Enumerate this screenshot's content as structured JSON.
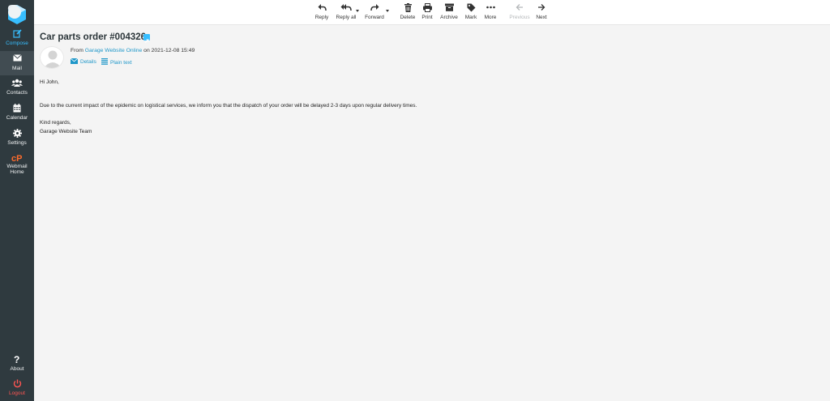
{
  "sidebar": {
    "items": [
      {
        "label": "Compose",
        "icon": "compose-icon"
      },
      {
        "label": "Mail",
        "icon": "mail-icon"
      },
      {
        "label": "Contacts",
        "icon": "contacts-icon"
      },
      {
        "label": "Calendar",
        "icon": "calendar-icon"
      },
      {
        "label": "Settings",
        "icon": "gear-icon"
      },
      {
        "label": "Webmail",
        "label2": "Home",
        "icon": "cpanel-icon"
      }
    ],
    "bottom": [
      {
        "label": "About",
        "icon": "question-icon"
      },
      {
        "label": "Logout",
        "icon": "power-icon"
      }
    ]
  },
  "toolbar": {
    "reply": "Reply",
    "reply_all": "Reply all",
    "forward": "Forward",
    "delete": "Delete",
    "print": "Print",
    "archive": "Archive",
    "mark": "Mark",
    "more": "More",
    "previous": "Previous",
    "next": "Next"
  },
  "message": {
    "subject": "Car parts order #004326",
    "from_prefix": "From",
    "sender": "Garage Website Online",
    "date_prefix": "on",
    "date": "2021-12-08 15:49",
    "details_label": "Details",
    "plain_text_label": "Plain text",
    "greeting": "Hi John,",
    "paragraph": "Due to the current impact of the epidemic on logistical services, we inform you that the dispatch of your order will be delayed 2-3 days upon regular delivery times.",
    "closing": "Kind regards,",
    "signature": "Garage Website Team"
  },
  "colors": {
    "sidebar_bg": "#2f3a3f",
    "accent": "#37beff",
    "link": "#1f97c9",
    "logout": "#ff5552",
    "content_bg": "#f4f4f4"
  }
}
